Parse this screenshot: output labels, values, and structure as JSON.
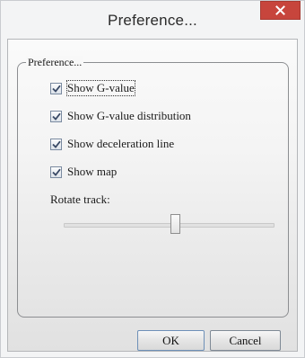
{
  "window": {
    "title": "Preference...",
    "close_icon": "close-icon",
    "close_color": "#c7453c"
  },
  "group": {
    "label": "Preference..."
  },
  "options": [
    {
      "label": "Show G-value",
      "checked": true,
      "focused": true
    },
    {
      "label": "Show G-value distribution",
      "checked": true
    },
    {
      "label": "Show deceleration line",
      "checked": true
    },
    {
      "label": "Show map",
      "checked": true
    }
  ],
  "rotate": {
    "label": "Rotate track:",
    "value_fraction": 0.53
  },
  "buttons": {
    "ok": "OK",
    "cancel": "Cancel"
  }
}
